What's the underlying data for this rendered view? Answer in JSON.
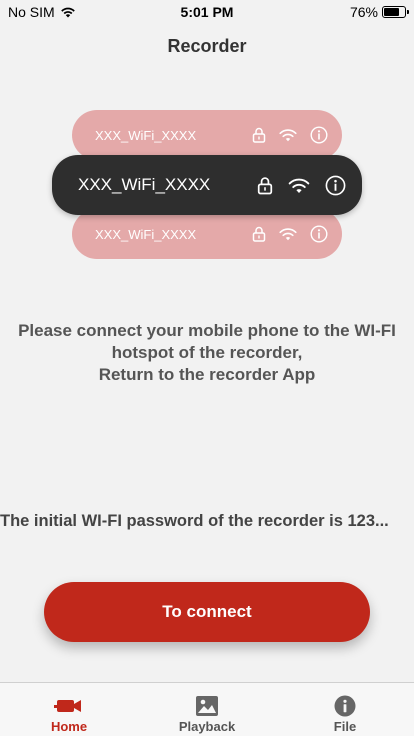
{
  "status_bar": {
    "carrier": "No SIM",
    "time": "5:01 PM",
    "battery": "76%",
    "battery_level": 0.76
  },
  "nav": {
    "title": "Recorder"
  },
  "wifi_list": [
    {
      "ssid": "XXX_WiFi_XXXX",
      "style": "light"
    },
    {
      "ssid": "XXX_WiFi_XXXX",
      "style": "dark"
    },
    {
      "ssid": "XXX_WiFi_XXXX",
      "style": "light"
    }
  ],
  "instructions": {
    "line1": "Please connect your mobile phone to the WI-FI",
    "line2": "hotspot of the recorder,",
    "line3": "Return to the recorder App"
  },
  "password_note": "The initial WI-FI password of the recorder is 123...",
  "connect_button": {
    "label": "To connect",
    "color": "#c0281b"
  },
  "tabs": [
    {
      "label": "Home",
      "icon": "camera-icon",
      "active": true
    },
    {
      "label": "Playback",
      "icon": "image-icon",
      "active": false
    },
    {
      "label": "File",
      "icon": "info-icon",
      "active": false
    }
  ],
  "colors": {
    "accent": "#c0281b",
    "pill_light": "#e4a9a9",
    "pill_dark": "#2e2e2e",
    "background": "#f2f2f2"
  }
}
